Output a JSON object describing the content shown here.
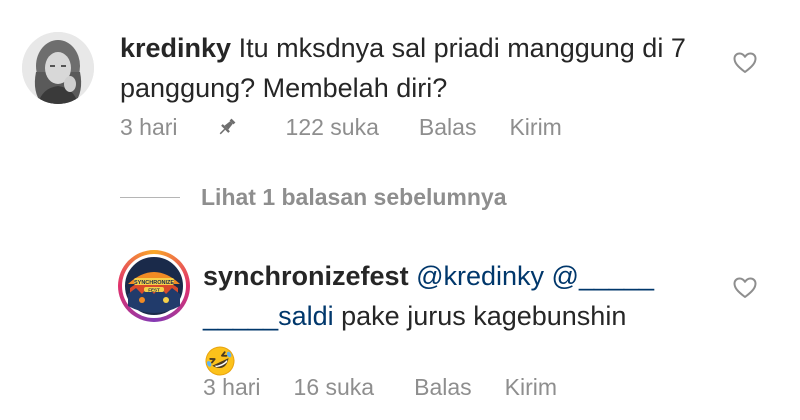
{
  "comments": [
    {
      "username": "kredinky",
      "text": "Itu mksdnya sal priadi manggung di 7 panggung? Membelah diri?",
      "time": "3 hari",
      "pinned": true,
      "likes": "122 suka",
      "reply_label": "Balas",
      "send_label": "Kirim"
    },
    {
      "username": "synchronizefest",
      "mention_1": "@kredinky",
      "mention_2": "@_____ _____saldi",
      "text": "pake jurus kagebunshin",
      "emoji": "rolling-on-floor-laughing",
      "time": "3 hari",
      "likes": "16 suka",
      "reply_label": "Balas",
      "send_label": "Kirim"
    }
  ],
  "view_replies_label": "Lihat 1 balasan sebelumnya",
  "icons": {
    "like": "heart-outline-icon",
    "pin": "pin-icon",
    "emoji": "rolling-on-floor-laughing-emoji"
  },
  "colors": {
    "text": "#262626",
    "meta": "#8e8e8e",
    "mention": "#00376b",
    "story_ring_start": "#f9a826",
    "story_ring_end": "#833ab4"
  }
}
